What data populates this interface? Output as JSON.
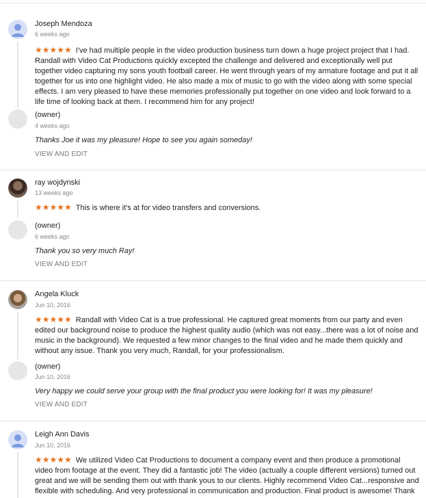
{
  "colors": {
    "star": "#e7711b",
    "divider": "#e5e5e5",
    "meta": "#888888",
    "link": "#777777",
    "default_avatar_bg": "#d6dff6",
    "default_avatar_fg": "#7b9be0",
    "owner_avatar": "#e6e6e6"
  },
  "reviews": [
    {
      "name": "Joseph Mendoza",
      "date": "6 weeks ago",
      "stars": "★★★★★",
      "rating": 5,
      "text": "I've had multiple people in the video production business turn down a huge project project that I had. Randall with Video Cat Productions quickly excepted the challenge and delivered and exceptionally well put together video capturing my sons youth football career. He went through years of my armature footage and put it all together for us into one highlight video. He also made a mix of music to go with the video along with some special effects. I am very pleased to have these memories professionally put together on one video and look forward to a life time of looking back at them. I recommend him for any project!",
      "avatar_icon": "person-icon",
      "reply": {
        "author": "(owner)",
        "date": "4 weeks ago",
        "text": "Thanks Joe it was my pleasure! Hope to see you again someday!",
        "action": "VIEW AND EDIT"
      }
    },
    {
      "name": "ray wojdynski",
      "date": "13 weeks ago",
      "stars": "★★★★★",
      "rating": 5,
      "text": "This is where it's at for video transfers and conversions.",
      "avatar_icon": "profile-photo",
      "reply": {
        "author": "(owner)",
        "date": "6 weeks ago",
        "text": "Thank you so very much Ray!",
        "action": "VIEW AND EDIT"
      }
    },
    {
      "name": "Angela Kluck",
      "date": "Jun 10, 2016",
      "stars": "★★★★★",
      "rating": 5,
      "text": "Randall with Video Cat is a true professional. He captured great moments from our party and even edited our background noise to produce the highest quality audio (which was not easy...there was a lot of noise and music in the background). We requested a few minor changes to the final video and he made them quickly and without any issue. Thank you very much, Randall, for your professionalism.",
      "avatar_icon": "profile-photo",
      "reply": {
        "author": "(owner)",
        "date": "Jun 10, 2016",
        "text": "Very happy we could serve your group with the final product you were looking for! It was my pleasure!",
        "action": "VIEW AND EDIT"
      }
    },
    {
      "name": "Leigh Ann Davis",
      "date": "Jun 10, 2016",
      "stars": "★★★★★",
      "rating": 5,
      "text": "We utilized Video Cat Productions to document a company event and then produce a promotional video from footage at the event. They did a fantastic job! The video (actually a couple different versions) turned out great and we will be sending them out with thank yous to our clients. Highly recommend Video Cat...responsive and flexible with scheduling. And very professional in communication and production. Final product is awesome! Thank you, Video Cat!",
      "avatar_icon": "person-icon"
    }
  ]
}
